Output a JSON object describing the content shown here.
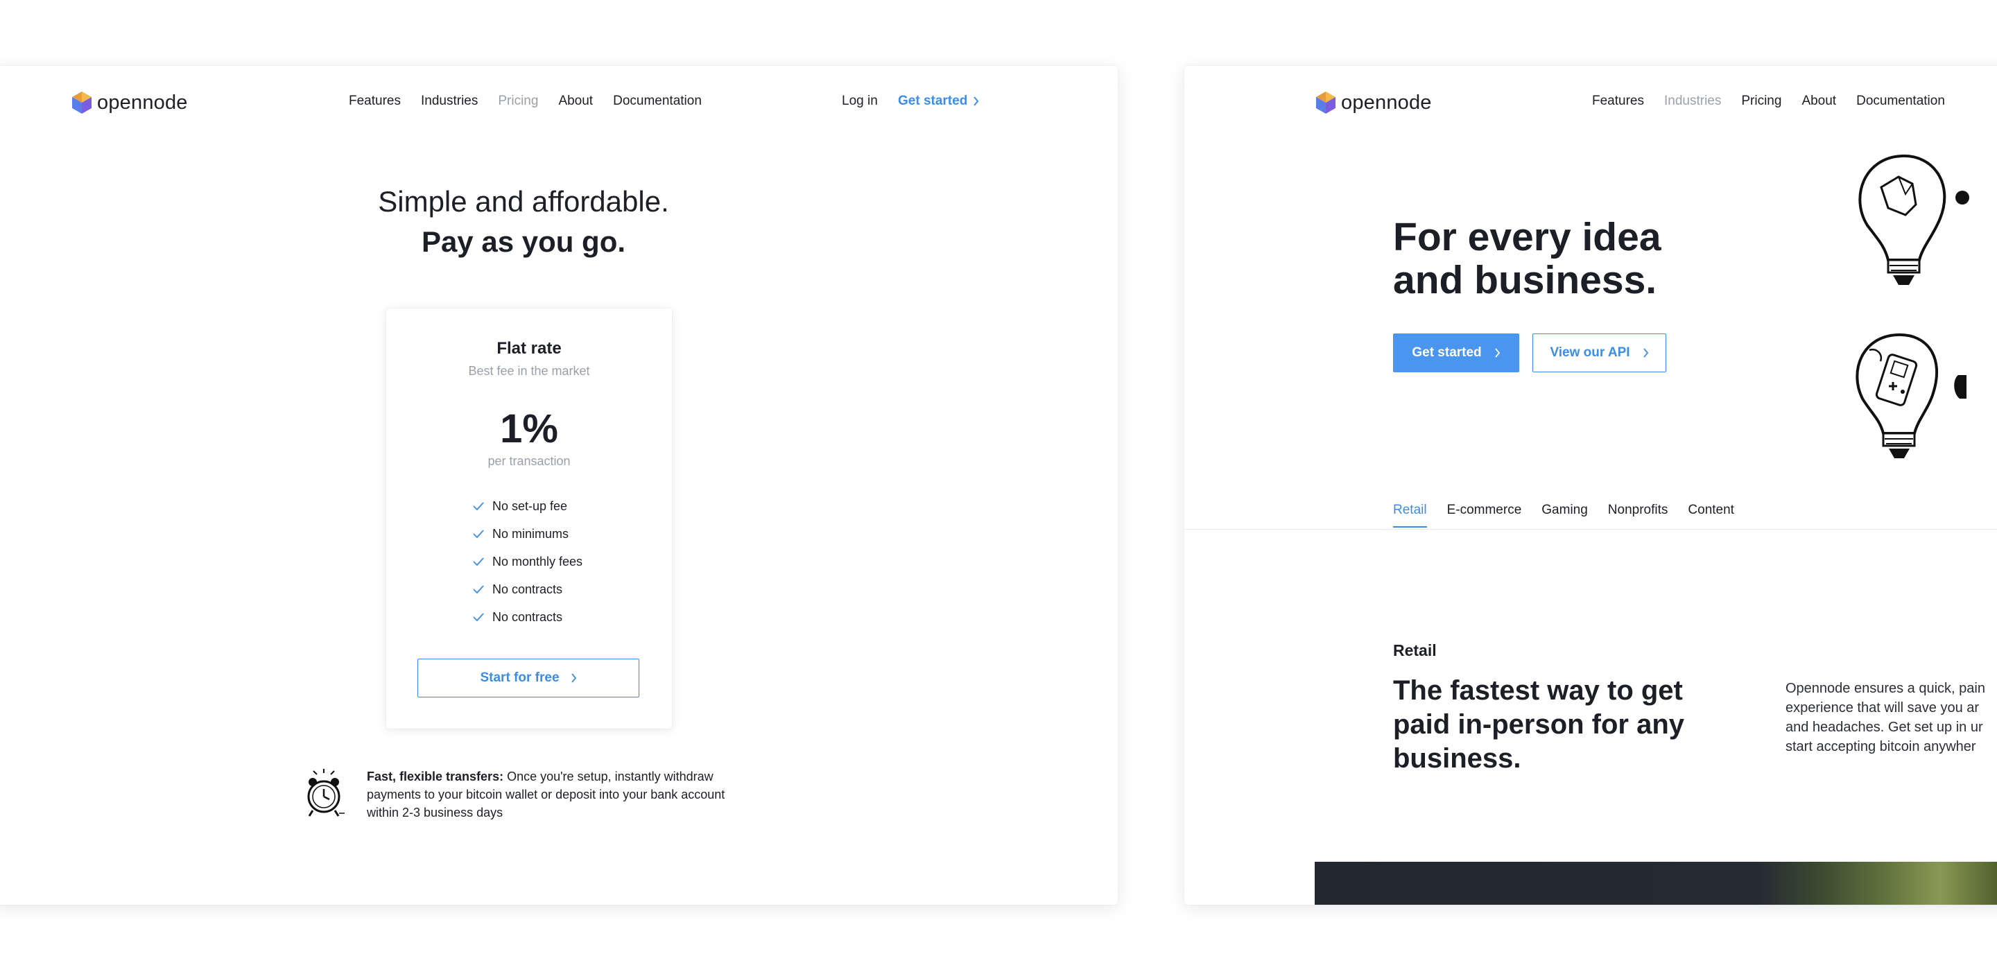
{
  "left": {
    "logo": "opennode",
    "nav": [
      "Features",
      "Industries",
      "Pricing",
      "About",
      "Documentation"
    ],
    "nav_active": "Pricing",
    "login": "Log in",
    "get_started": "Get started",
    "hero_line1": "Simple and affordable.",
    "hero_line2": "Pay as you go.",
    "card": {
      "plan": "Flat rate",
      "plan_sub": "Best fee in the market",
      "price": "1%",
      "price_sub": "per transaction",
      "features": [
        "No set-up fee",
        "No minimums",
        "No monthly fees",
        "No contracts",
        "No contracts"
      ],
      "cta": "Start for free"
    },
    "transfer_bold": "Fast, flexible transfers:",
    "transfer_text": " Once you're setup, instantly withdraw payments to your bitcoin wallet or deposit into your bank account within 2-3 business days"
  },
  "right": {
    "logo": "opennode",
    "nav": [
      "Features",
      "Industries",
      "Pricing",
      "About",
      "Documentation"
    ],
    "nav_active": "Industries",
    "hero_line1": "For every idea",
    "hero_line2": "and business.",
    "btn_primary": "Get started",
    "btn_outline": "View our API",
    "tabs": [
      "Retail",
      "E-commerce",
      "Gaming",
      "Nonprofits",
      "Content"
    ],
    "tab_active": "Retail",
    "section_label": "Retail",
    "section_title": "The fastest way to get paid in-person for any business.",
    "section_body_lines": [
      "Opennode ensures a quick, pain",
      "experience that will save you ar",
      "and headaches. Get set up in ur",
      "start accepting bitcoin anywher"
    ]
  },
  "colors": {
    "accent": "#3b8de8",
    "button_fill": "#4a95ed",
    "muted": "#9aa0a8",
    "text": "#1c1f26"
  }
}
